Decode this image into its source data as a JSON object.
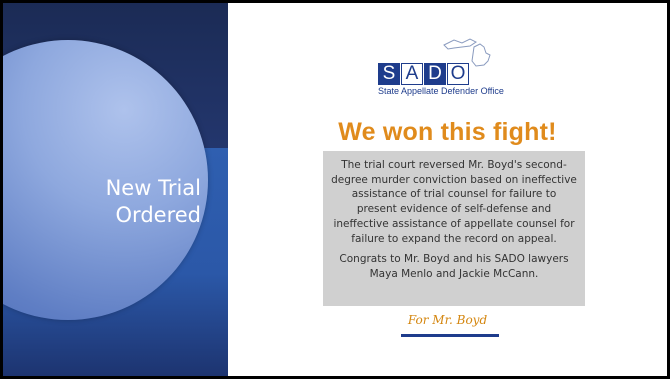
{
  "slide": {
    "title": "New Trial Ordered"
  },
  "logo": {
    "letters": [
      "S",
      "A",
      "D",
      "O"
    ],
    "subtitle": "State Appellate Defender Office"
  },
  "headline": "We won this fight!",
  "summary": {
    "paragraph1": "The trial court reversed Mr. Boyd's second-degree murder conviction based on ineffective assistance of trial counsel for failure to present evidence of self-defense and ineffective assistance of appellate counsel for failure to expand the record on appeal.",
    "paragraph2": "Congrats to Mr. Boyd and his SADO lawyers Maya Menlo and Jackie McCann."
  },
  "signature": "For Mr. Boyd",
  "colors": {
    "navy": "#1e3c8c",
    "orange": "#e08b1c",
    "panel_dark": "#1b2d5e",
    "panel_blue": "#2f5fb0",
    "circle": "#8ea8de",
    "box_gray": "#d0d0d0"
  }
}
